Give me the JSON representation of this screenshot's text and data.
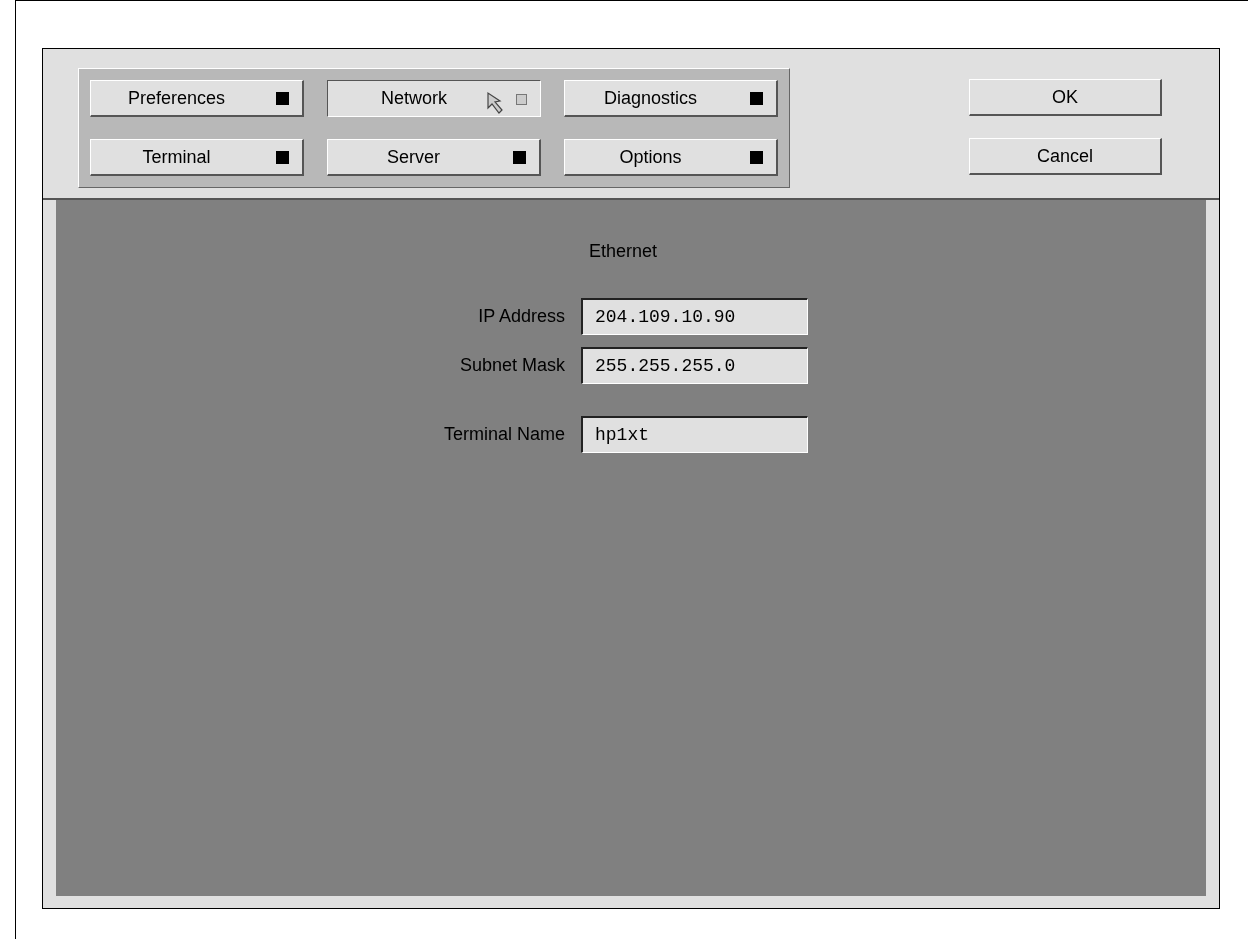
{
  "tabs": [
    {
      "label": "Preferences",
      "selected": false
    },
    {
      "label": "Network",
      "selected": true
    },
    {
      "label": "Diagnostics",
      "selected": false
    },
    {
      "label": "Terminal",
      "selected": false
    },
    {
      "label": "Server",
      "selected": false
    },
    {
      "label": "Options",
      "selected": false
    }
  ],
  "buttons": [
    "OK",
    "Cancel"
  ],
  "section_title": "Ethernet",
  "fields": [
    {
      "label": "IP Address",
      "value": "204.109.10.90"
    },
    {
      "label": "Subnet Mask",
      "value": "255.255.255.0"
    },
    {
      "label": "Terminal Name",
      "value": "hp1xt"
    }
  ]
}
